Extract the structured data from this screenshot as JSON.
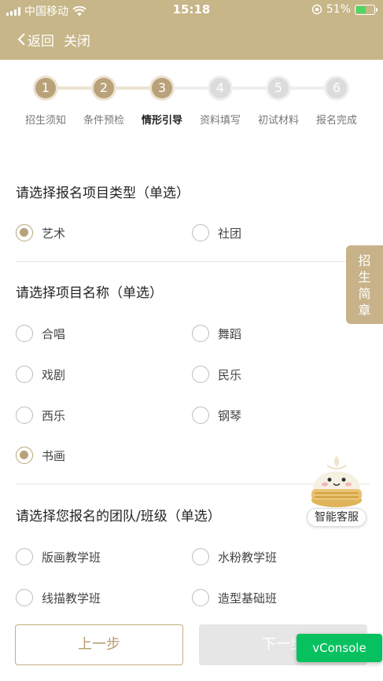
{
  "status_bar": {
    "carrier": "中国移动",
    "time": "15:18",
    "battery": "51%"
  },
  "nav": {
    "back": "返回",
    "close": "关闭"
  },
  "steps": [
    {
      "num": "1",
      "label": "招生须知"
    },
    {
      "num": "2",
      "label": "条件预检"
    },
    {
      "num": "3",
      "label": "情形引导"
    },
    {
      "num": "4",
      "label": "资料填写"
    },
    {
      "num": "5",
      "label": "初试材料"
    },
    {
      "num": "6",
      "label": "报名完成"
    }
  ],
  "current_step": 3,
  "sections": {
    "project_type": {
      "title": "请选择报名项目类型（单选）",
      "options": [
        "艺术",
        "社团"
      ],
      "selected": "艺术"
    },
    "project_name": {
      "title": "请选择项目名称（单选）",
      "options": [
        "合唱",
        "舞蹈",
        "戏剧",
        "民乐",
        "西乐",
        "钢琴",
        "书画"
      ],
      "selected": "书画"
    },
    "team": {
      "title": "请选择您报名的团队/班级（单选）",
      "options": [
        "版画教学班",
        "水粉教学班",
        "线描教学班",
        "造型基础班"
      ],
      "selected": ""
    }
  },
  "side_tab": "招生简章",
  "assistant": "智能客服",
  "buttons": {
    "prev": "上一步",
    "next": "下一步"
  },
  "vconsole": "vConsole",
  "colors": {
    "header": "#c7b688",
    "accent": "#b9a27a",
    "vconsole": "#07c160"
  }
}
